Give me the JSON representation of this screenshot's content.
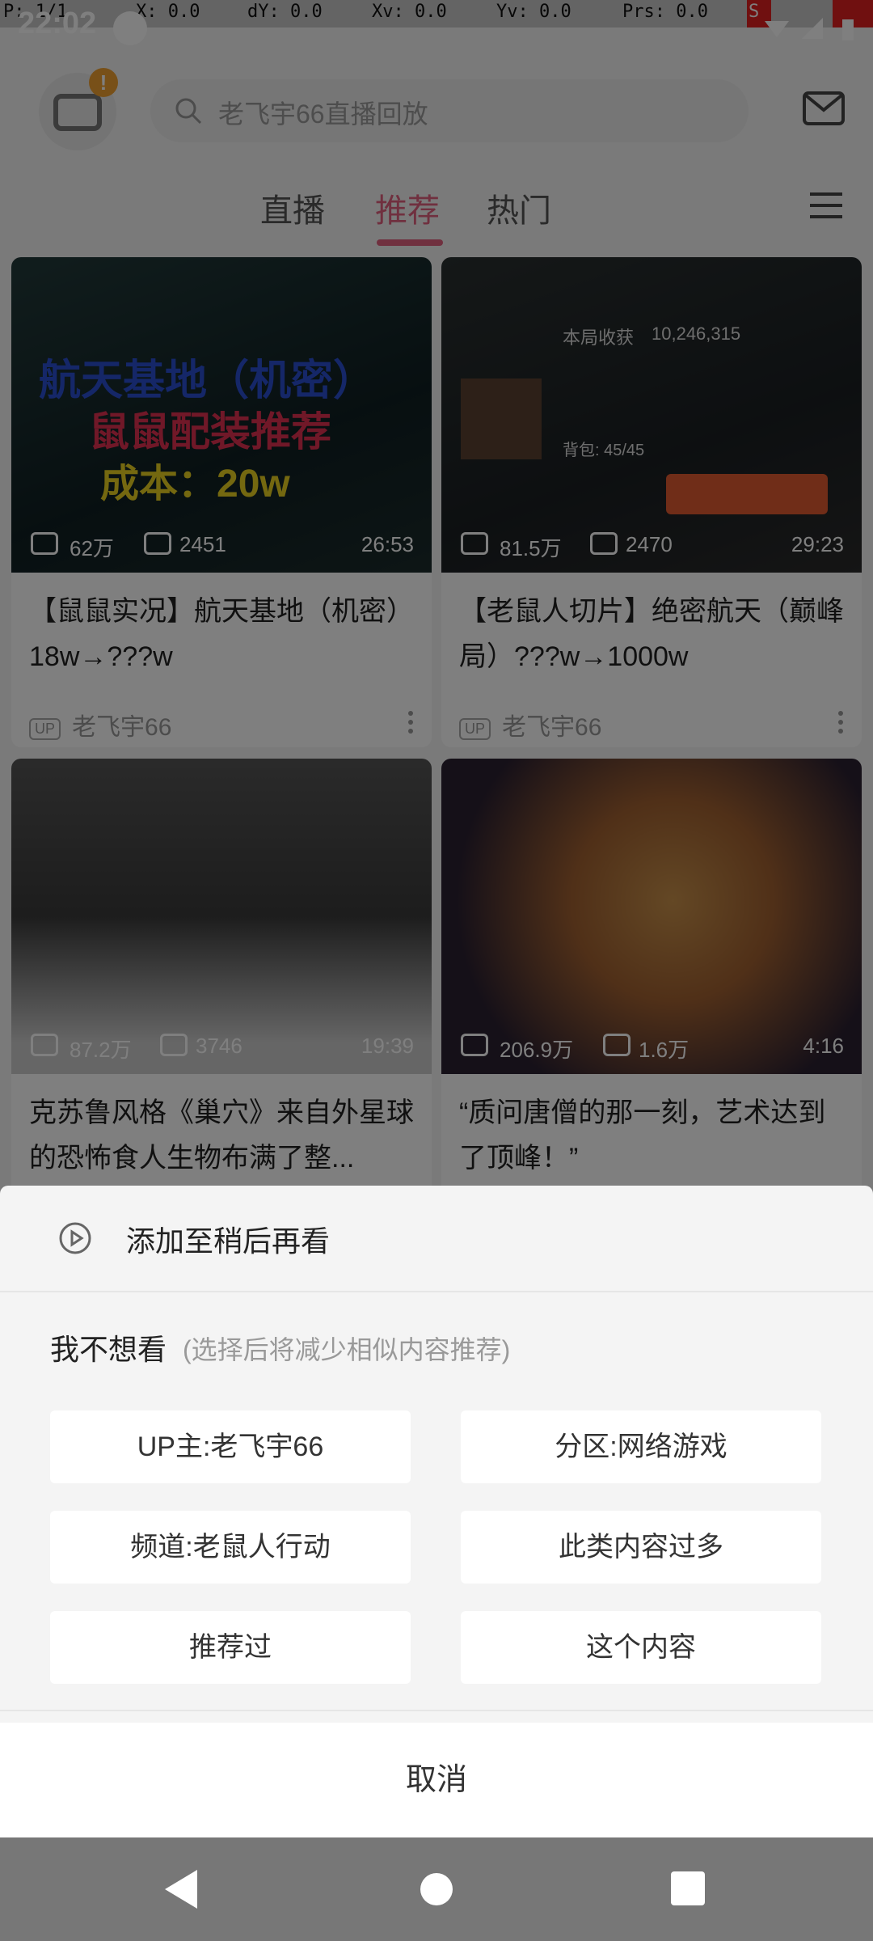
{
  "status_bar": {
    "debug": {
      "p": "P: 1/1",
      "x": "X: 0.0",
      "dy": "dY: 0.0",
      "xv": "Xv: 0.0",
      "yv": "Yv: 0.0",
      "prs": "Prs: 0.0",
      "s": "S"
    },
    "time": "22:02"
  },
  "header": {
    "badge": "!",
    "search_placeholder": "老飞宇66直播回放"
  },
  "tabs": [
    "直播",
    "推荐",
    "热门"
  ],
  "active_tab": "推荐",
  "accent_color": "#e0607e",
  "feed": [
    {
      "views": "62万",
      "comments": "2451",
      "duration": "26:53",
      "title": "【鼠鼠实况】航天基地（机密）18w→???w",
      "up_tag": "UP",
      "author": "老飞宇66",
      "thumb_text": [
        "航天基地（机密）",
        "鼠鼠配装推荐",
        "成本：20w"
      ]
    },
    {
      "views": "81.5万",
      "comments": "2470",
      "duration": "29:23",
      "title": "【老鼠人切片】绝密航天（巅峰局）???w→1000w",
      "up_tag": "UP",
      "author": "老飞宇66",
      "thumb_text": [
        "本局收获",
        "10,246,315",
        "背包: 45/45"
      ]
    },
    {
      "views": "87.2万",
      "comments": "3746",
      "duration": "19:39",
      "title": "克苏鲁风格《巢穴》来自外星球的恐怖食人生物布满了整..."
    },
    {
      "views": "206.9万",
      "comments": "1.6万",
      "duration": "4:16",
      "title": "“质问唐僧的那一刻，艺术达到了顶峰！”"
    }
  ],
  "sheet": {
    "watch_later": "添加至稍后再看",
    "dislike_title": "我不想看",
    "dislike_sub": "(选择后将减少相似内容推荐)",
    "options": [
      "UP主:老飞宇66",
      "分区:网络游戏",
      "频道:老鼠人行动",
      "此类内容过多",
      "推荐过",
      "这个内容"
    ],
    "cancel": "取消"
  }
}
